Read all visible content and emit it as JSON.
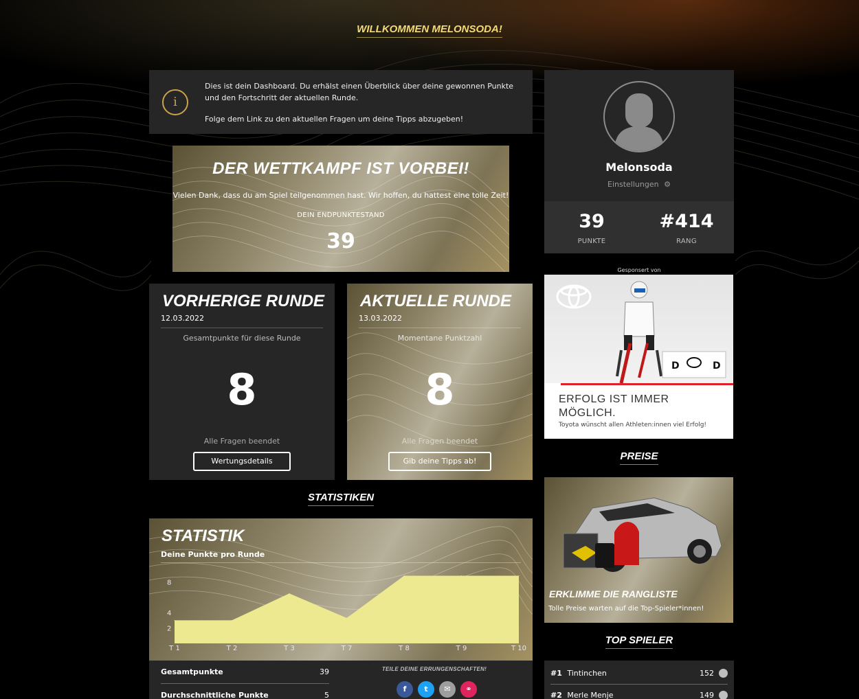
{
  "welcome": "WILLKOMMEN MELONSODA!",
  "info": {
    "icon": "info-icon",
    "line1": "Dies ist dein Dashboard. Du erhälst einen Überblick über deine gewonnen Punkte und den Fortschritt der aktuellen Runde.",
    "line2": "Folge dem Link zu den aktuellen Fragen um deine Tipps abzugeben!"
  },
  "competition": {
    "title": "DER WETTKAMPF IST VORBEI!",
    "thanks": "Vielen Dank, dass du am Spiel teilgenommen hast. Wir hoffen, du hattest eine tolle Zeit!",
    "final_label": "DEIN ENDPUNKTESTAND",
    "final_value": "39"
  },
  "previous_round": {
    "title": "VORHERIGE RUNDE",
    "date": "12.03.2022",
    "subtitle": "Gesamtpunkte für diese Runde",
    "value": "8",
    "status": "Alle Fragen beendet",
    "button": "Wertungsdetails"
  },
  "current_round": {
    "title": "AKTUELLE RUNDE",
    "date": "13.03.2022",
    "subtitle": "Momentane Punktzahl",
    "value": "8",
    "status": "Alle Fragen beendet",
    "button": "Gib deine Tipps ab!"
  },
  "statistics_section": "STATISTIKEN",
  "statistic": {
    "title": "STATISTIK",
    "subtitle": "Deine Punkte pro Runde",
    "total_label": "Gesamtpunkte",
    "total_value": "39",
    "avg_label": "Durchschnittliche Punkte",
    "avg_value": "5",
    "share_label": "TEILE DEINE ERRUNGENSCHAFTEN!",
    "share_buttons": [
      {
        "name": "facebook-icon",
        "glyph": "f",
        "color": "#3b5998"
      },
      {
        "name": "twitter-icon",
        "glyph": "t",
        "color": "#1da1f2"
      },
      {
        "name": "email-icon",
        "glyph": "✉",
        "color": "#9e9e9e"
      },
      {
        "name": "link-icon",
        "glyph": "⚭",
        "color": "#e0245e"
      }
    ]
  },
  "chart_data": {
    "type": "area",
    "categories": [
      "T 1",
      "T 2",
      "T 3",
      "T 7",
      "T 8",
      "T 9",
      "T 10"
    ],
    "values": [
      3,
      3,
      6.5,
      3.3,
      8.8,
      8.8,
      8.8
    ],
    "y_ticks": [
      2,
      4,
      8
    ],
    "ylim": [
      0,
      10
    ],
    "color": "#ece991"
  },
  "profile": {
    "name": "Melonsoda",
    "settings": "Einstellungen",
    "points": "39",
    "points_label": "PUNKTE",
    "rank": "#414",
    "rank_label": "RANG"
  },
  "sponsor": {
    "label": "Gesponsert von",
    "slogan_line1": "ERFOLG IST IMMER",
    "slogan_line2": "MÖGLICH.",
    "small": "Toyota wünscht allen Athleten:innen viel Erfolg!"
  },
  "prizes": {
    "section": "PREISE",
    "caption": "ERKLIMME DIE RANGLISTE",
    "desc": "Tolle Preise warten auf die Top-Spieler*innen!"
  },
  "top_players": {
    "section": "TOP SPIELER",
    "items": [
      {
        "rank": "#1",
        "name": "Tintinchen",
        "points": "152"
      },
      {
        "rank": "#2",
        "name": "Merle Menje",
        "points": "149"
      }
    ]
  }
}
